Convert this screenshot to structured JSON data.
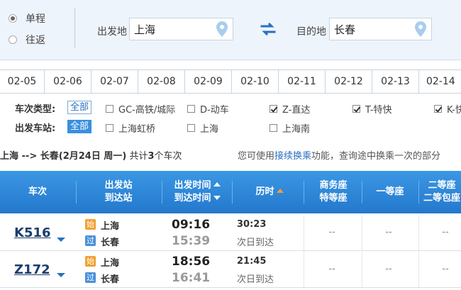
{
  "trip_type": {
    "one_way": "单程",
    "round_trip": "往返"
  },
  "from": {
    "label": "出发地",
    "value": "上海"
  },
  "to": {
    "label": "目的地",
    "value": "长春"
  },
  "dates": [
    "02-05",
    "02-06",
    "02-07",
    "02-08",
    "02-09",
    "02-10",
    "02-11",
    "02-12",
    "02-13",
    "02-14"
  ],
  "filters": {
    "type_label": "车次类型:",
    "type_all": "全部",
    "types": [
      {
        "label": "GC-高铁/城际",
        "checked": false
      },
      {
        "label": "D-动车",
        "checked": false
      },
      {
        "label": "Z-直达",
        "checked": true
      },
      {
        "label": "T-特快",
        "checked": true
      },
      {
        "label": "K-快",
        "checked": true
      }
    ],
    "station_label": "出发车站:",
    "station_all": "全部",
    "stations": [
      {
        "label": "上海虹桥",
        "checked": false
      },
      {
        "label": "上海",
        "checked": false
      },
      {
        "label": "上海南",
        "checked": false
      }
    ]
  },
  "info": {
    "route": "上海 --> 长春",
    "date_open": "(",
    "date": "2月24日",
    "weekday": " 周一)",
    "count_pre": "共计",
    "count": "3",
    "count_post": "个车次",
    "hint_pre": "您可使用",
    "hint_link": "接续换乘",
    "hint_post": "功能，查询途中换乘一次的部分"
  },
  "table_header": {
    "train": "车次",
    "station_1": "出发站",
    "station_2": "到达站",
    "time_1": "出发时间",
    "time_2": "到达时间",
    "duration": "历时",
    "business_1": "商务座",
    "business_2": "特等座",
    "first": "一等座",
    "second_1": "二等座",
    "second_2": "二等包座"
  },
  "rows": [
    {
      "train": "K516",
      "from_badge": "始",
      "from": "上海",
      "to_badge": "过",
      "to": "长春",
      "dep": "09:16",
      "arr": "15:39",
      "duration": "30:23",
      "arrive_note": "次日到达",
      "business": "--",
      "first": "--",
      "second": "--"
    },
    {
      "train": "Z172",
      "from_badge": "始",
      "from": "上海",
      "to_badge": "过",
      "to": "长春",
      "dep": "18:56",
      "arr": "16:41",
      "duration": "21:45",
      "arrive_note": "次日到达",
      "business": "--",
      "first": "--",
      "second": "--"
    }
  ],
  "colors": {
    "accent": "#2a78cc",
    "header": "#3b97e4",
    "start_badge": "#f0a030",
    "pass_badge": "#4a90d9"
  }
}
